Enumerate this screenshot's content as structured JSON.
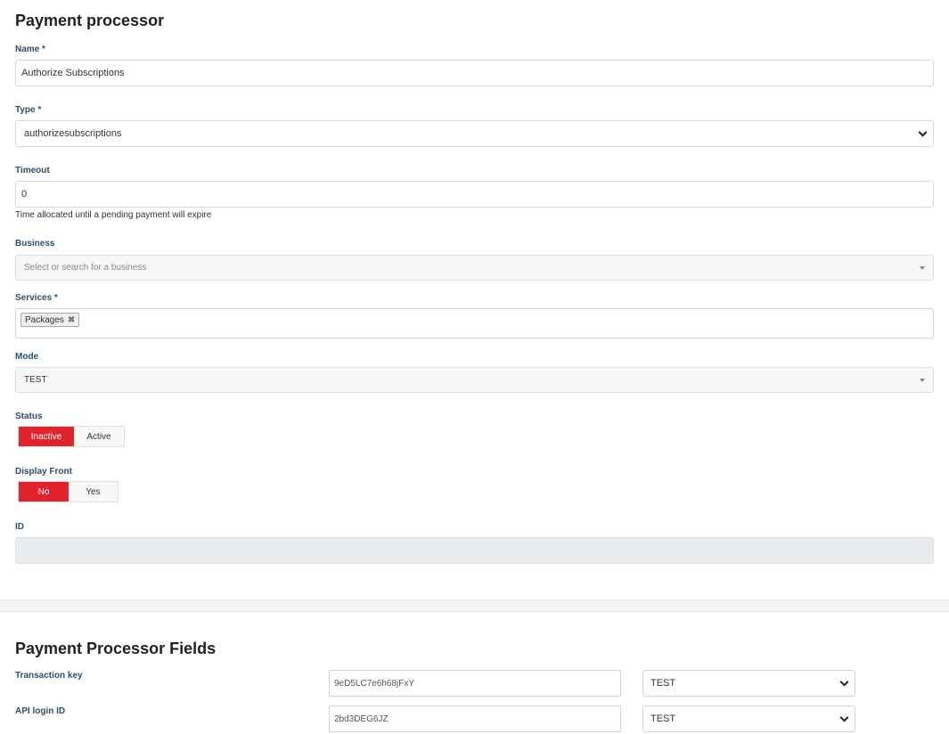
{
  "form": {
    "title": "Payment processor",
    "name": {
      "label": "Name *",
      "value": "Authorize Subscriptions"
    },
    "type": {
      "label": "Type *",
      "value": "authorizesubscriptions"
    },
    "timeout": {
      "label": "Timeout",
      "value": "0",
      "help": "Time allocated until a pending payment will expire"
    },
    "business": {
      "label": "Business",
      "placeholder": "Select or search for a business"
    },
    "services": {
      "label": "Services *",
      "tags": [
        {
          "label": "Packages",
          "remove_icon": "close-icon"
        }
      ]
    },
    "mode": {
      "label": "Mode",
      "value": "TEST"
    },
    "status": {
      "label": "Status",
      "options": [
        "Inactive",
        "Active"
      ],
      "selected": "Inactive"
    },
    "display_front": {
      "label": "Display Front",
      "options": [
        "No",
        "Yes"
      ],
      "selected": "No"
    },
    "id": {
      "label": "ID",
      "value": ""
    }
  },
  "fields": {
    "title": "Payment Processor Fields",
    "rows": [
      {
        "label": "Transaction key",
        "value": "9eD5LC7e6h68jFxY",
        "mode": "TEST"
      },
      {
        "label": "API login ID",
        "value": "2bd3DEG6JZ",
        "mode": "TEST"
      }
    ]
  },
  "colors": {
    "accent_red": "#e1232e",
    "label_blue": "#2c4f6e"
  }
}
